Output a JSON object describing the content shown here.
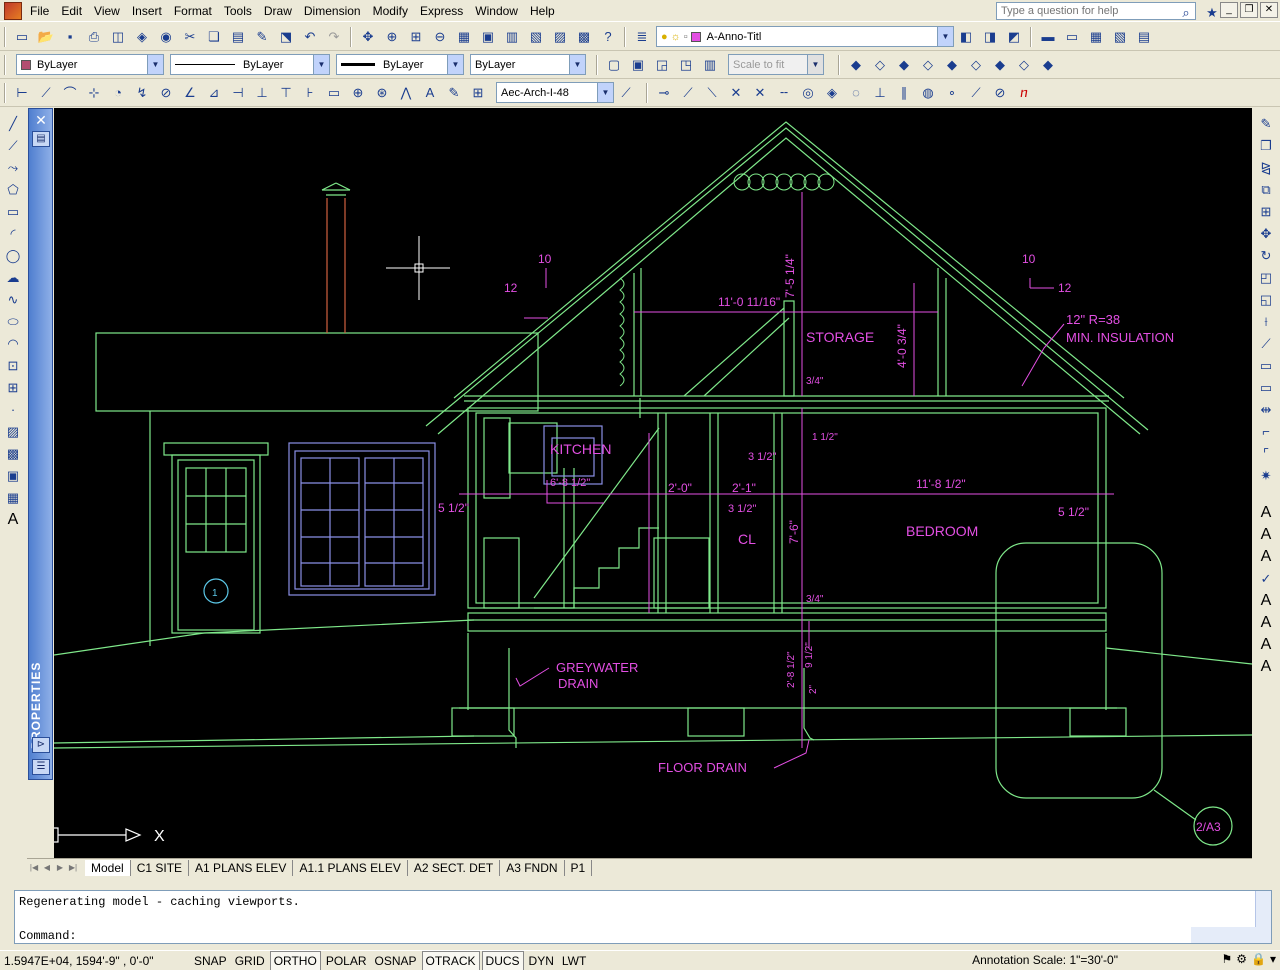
{
  "menu": [
    "File",
    "Edit",
    "View",
    "Insert",
    "Format",
    "Tools",
    "Draw",
    "Dimension",
    "Modify",
    "Express",
    "Window",
    "Help"
  ],
  "help_search": {
    "placeholder": "Type a question for help"
  },
  "layer_combo": "A-Anno-Titl",
  "properties": {
    "color": "ByLayer",
    "linetype": "ByLayer",
    "lineweight": "ByLayer",
    "plotstyle": "ByLayer",
    "scale": "Scale to fit"
  },
  "dimstyle": "Aec-Arch-I-48",
  "palette": {
    "title": "PROPERTIES"
  },
  "layout_tabs": [
    "Model",
    "C1 SITE",
    "A1 PLANS ELEV",
    "A1.1 PLANS ELEV",
    "A2 SECT. DET",
    "A3 FNDN",
    "P1"
  ],
  "command": {
    "history": "Regenerating model - caching viewports.",
    "prompt": "Command:"
  },
  "status": {
    "coords": "1.5947E+04,  1594'-9\"  , 0'-0\"",
    "buttons": [
      "SNAP",
      "GRID",
      "ORTHO",
      "POLAR",
      "OSNAP",
      "OTRACK",
      "DUCS",
      "DYN",
      "LWT"
    ],
    "on": [
      "ORTHO",
      "OTRACK",
      "DUCS"
    ],
    "annotation_scale": "Annotation Scale:  1\"=30'-0\""
  },
  "drawing": {
    "room_labels": [
      "STORAGE",
      "KITCHEN",
      "CL",
      "BEDROOM"
    ],
    "dims": [
      "11'-0 11/16\"",
      "7'-5 1/4\"",
      "4'-0 3/4\"",
      "3/4\"",
      "1 1/2\"",
      "3 1/2\"",
      "2'-0\"",
      "2'-1\"",
      "3 1/2\"",
      "11'-8 1/2\"",
      "6'-8 1/2\"",
      "7'-6\"",
      "5 1/2\"",
      "5 1/2\"",
      "3/4\"",
      "9 1/2\"",
      "2'-8 1/2\"",
      "2\""
    ],
    "annotations": [
      "12\" R=38",
      "MIN. INSULATION",
      "GREYWATER",
      "DRAIN",
      "FLOOR DRAIN",
      "2/A3",
      "10",
      "12",
      "10",
      "12",
      "1"
    ],
    "ucs_label": "X"
  },
  "colors": {
    "canvas": "#000000",
    "wall": "#7fe88a",
    "dim": "#e34fe3",
    "window": "#8a8fe6",
    "chimney": "#d06040",
    "accent_palette": "#4f7ecf"
  }
}
